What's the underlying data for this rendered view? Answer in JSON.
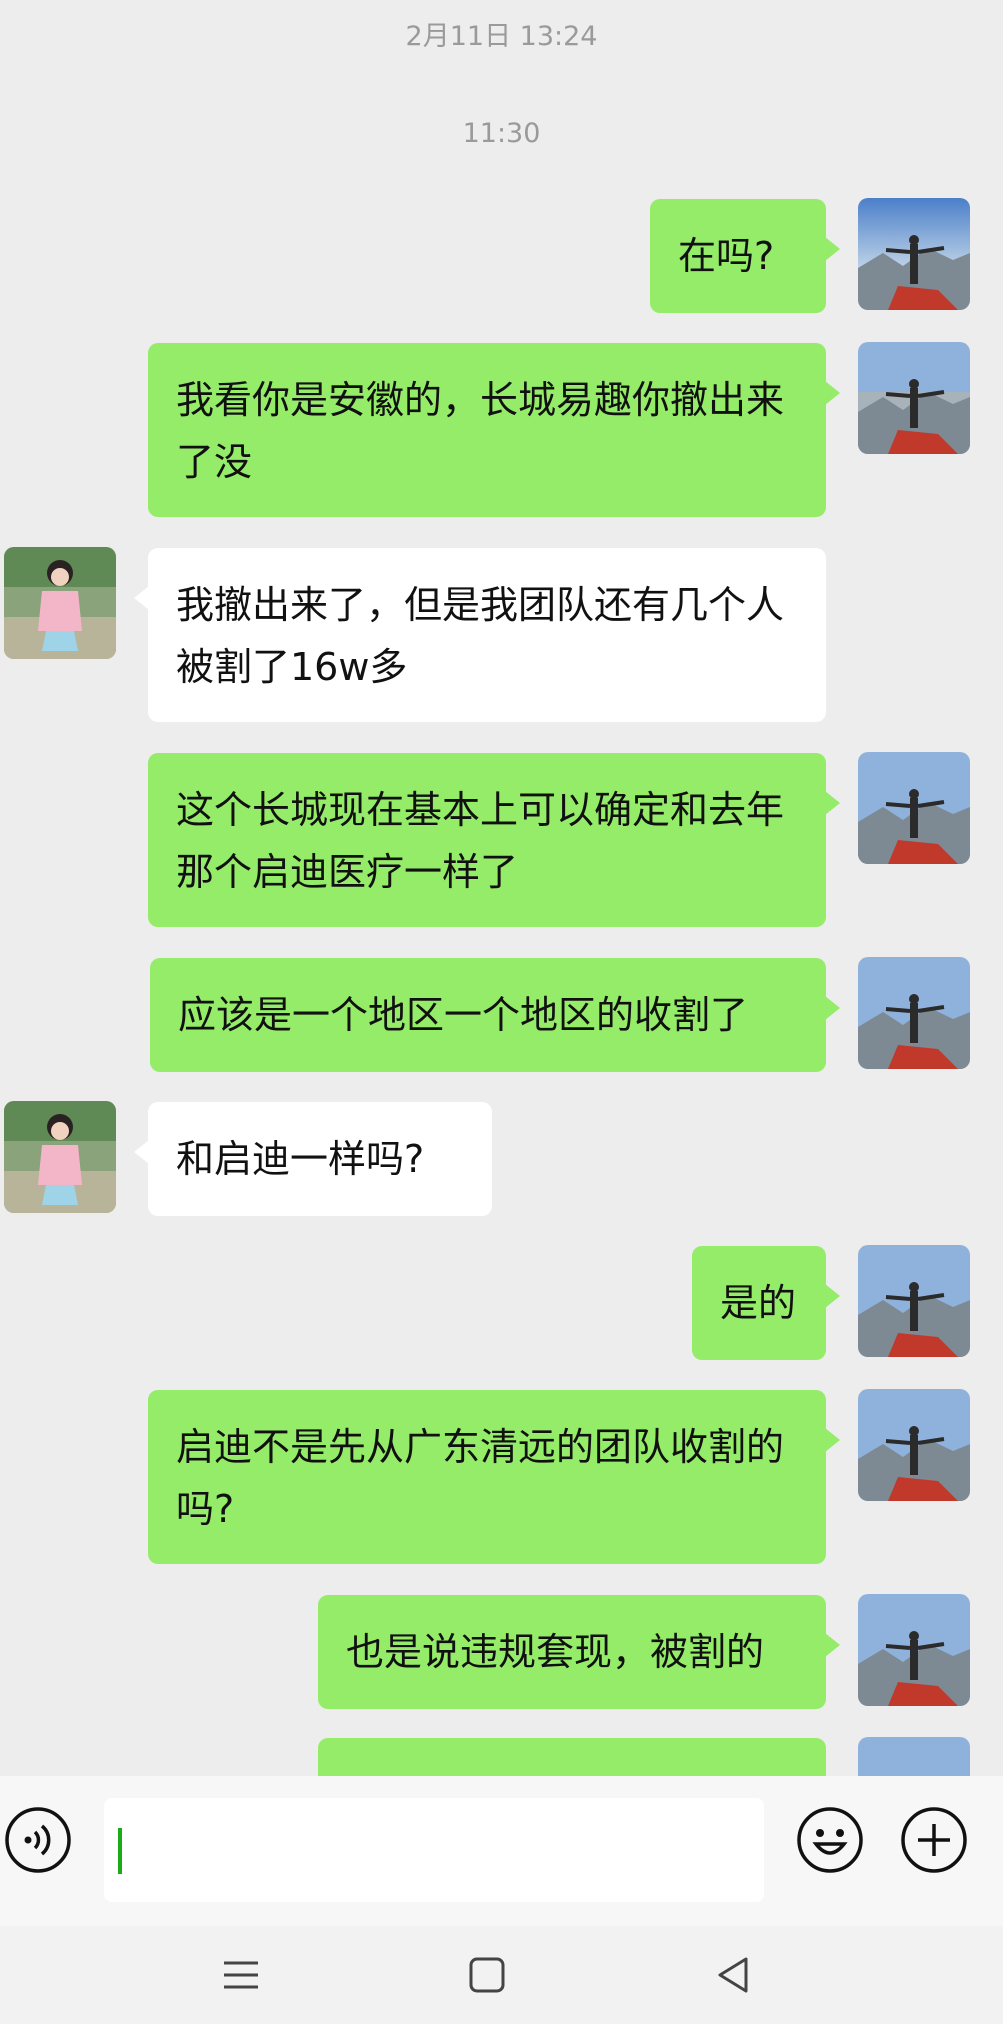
{
  "timestamps": [
    "2月11日 13:24",
    "11:30"
  ],
  "contacts": {
    "me": {
      "avatar": "avatar-man-on-mountain"
    },
    "other": {
      "avatar": "avatar-girl-in-pink"
    }
  },
  "messages": [
    {
      "side": "out",
      "text": "在吗?"
    },
    {
      "side": "out",
      "text": "我看你是安徽的，长城易趣你撤出来了没"
    },
    {
      "side": "in",
      "text": "我撤出来了，但是我团队还有几个人被割了16w多"
    },
    {
      "side": "out",
      "text": "这个长城现在基本上可以确定和去年那个启迪医疗一样了"
    },
    {
      "side": "out",
      "text": "应该是一个地区一个地区的收割了"
    },
    {
      "side": "in",
      "text": "和启迪一样吗?"
    },
    {
      "side": "out",
      "text": "是的"
    },
    {
      "side": "out",
      "text": "启迪不是先从广东清远的团队收割的吗?"
    },
    {
      "side": "out",
      "text": "也是说违规套现，被割的"
    },
    {
      "side": "out",
      "text": ""
    }
  ],
  "input_bar": {
    "voice_icon": "voice-icon",
    "emoji_icon": "emoji-icon",
    "plus_icon": "plus-icon",
    "value": ""
  },
  "nav_bar": {
    "icons": [
      "menu-icon",
      "home-icon",
      "back-icon"
    ]
  },
  "colors": {
    "outgoing": "#95ec69",
    "incoming": "#ffffff",
    "background": "#ededed",
    "cursor": "#1aad19"
  }
}
